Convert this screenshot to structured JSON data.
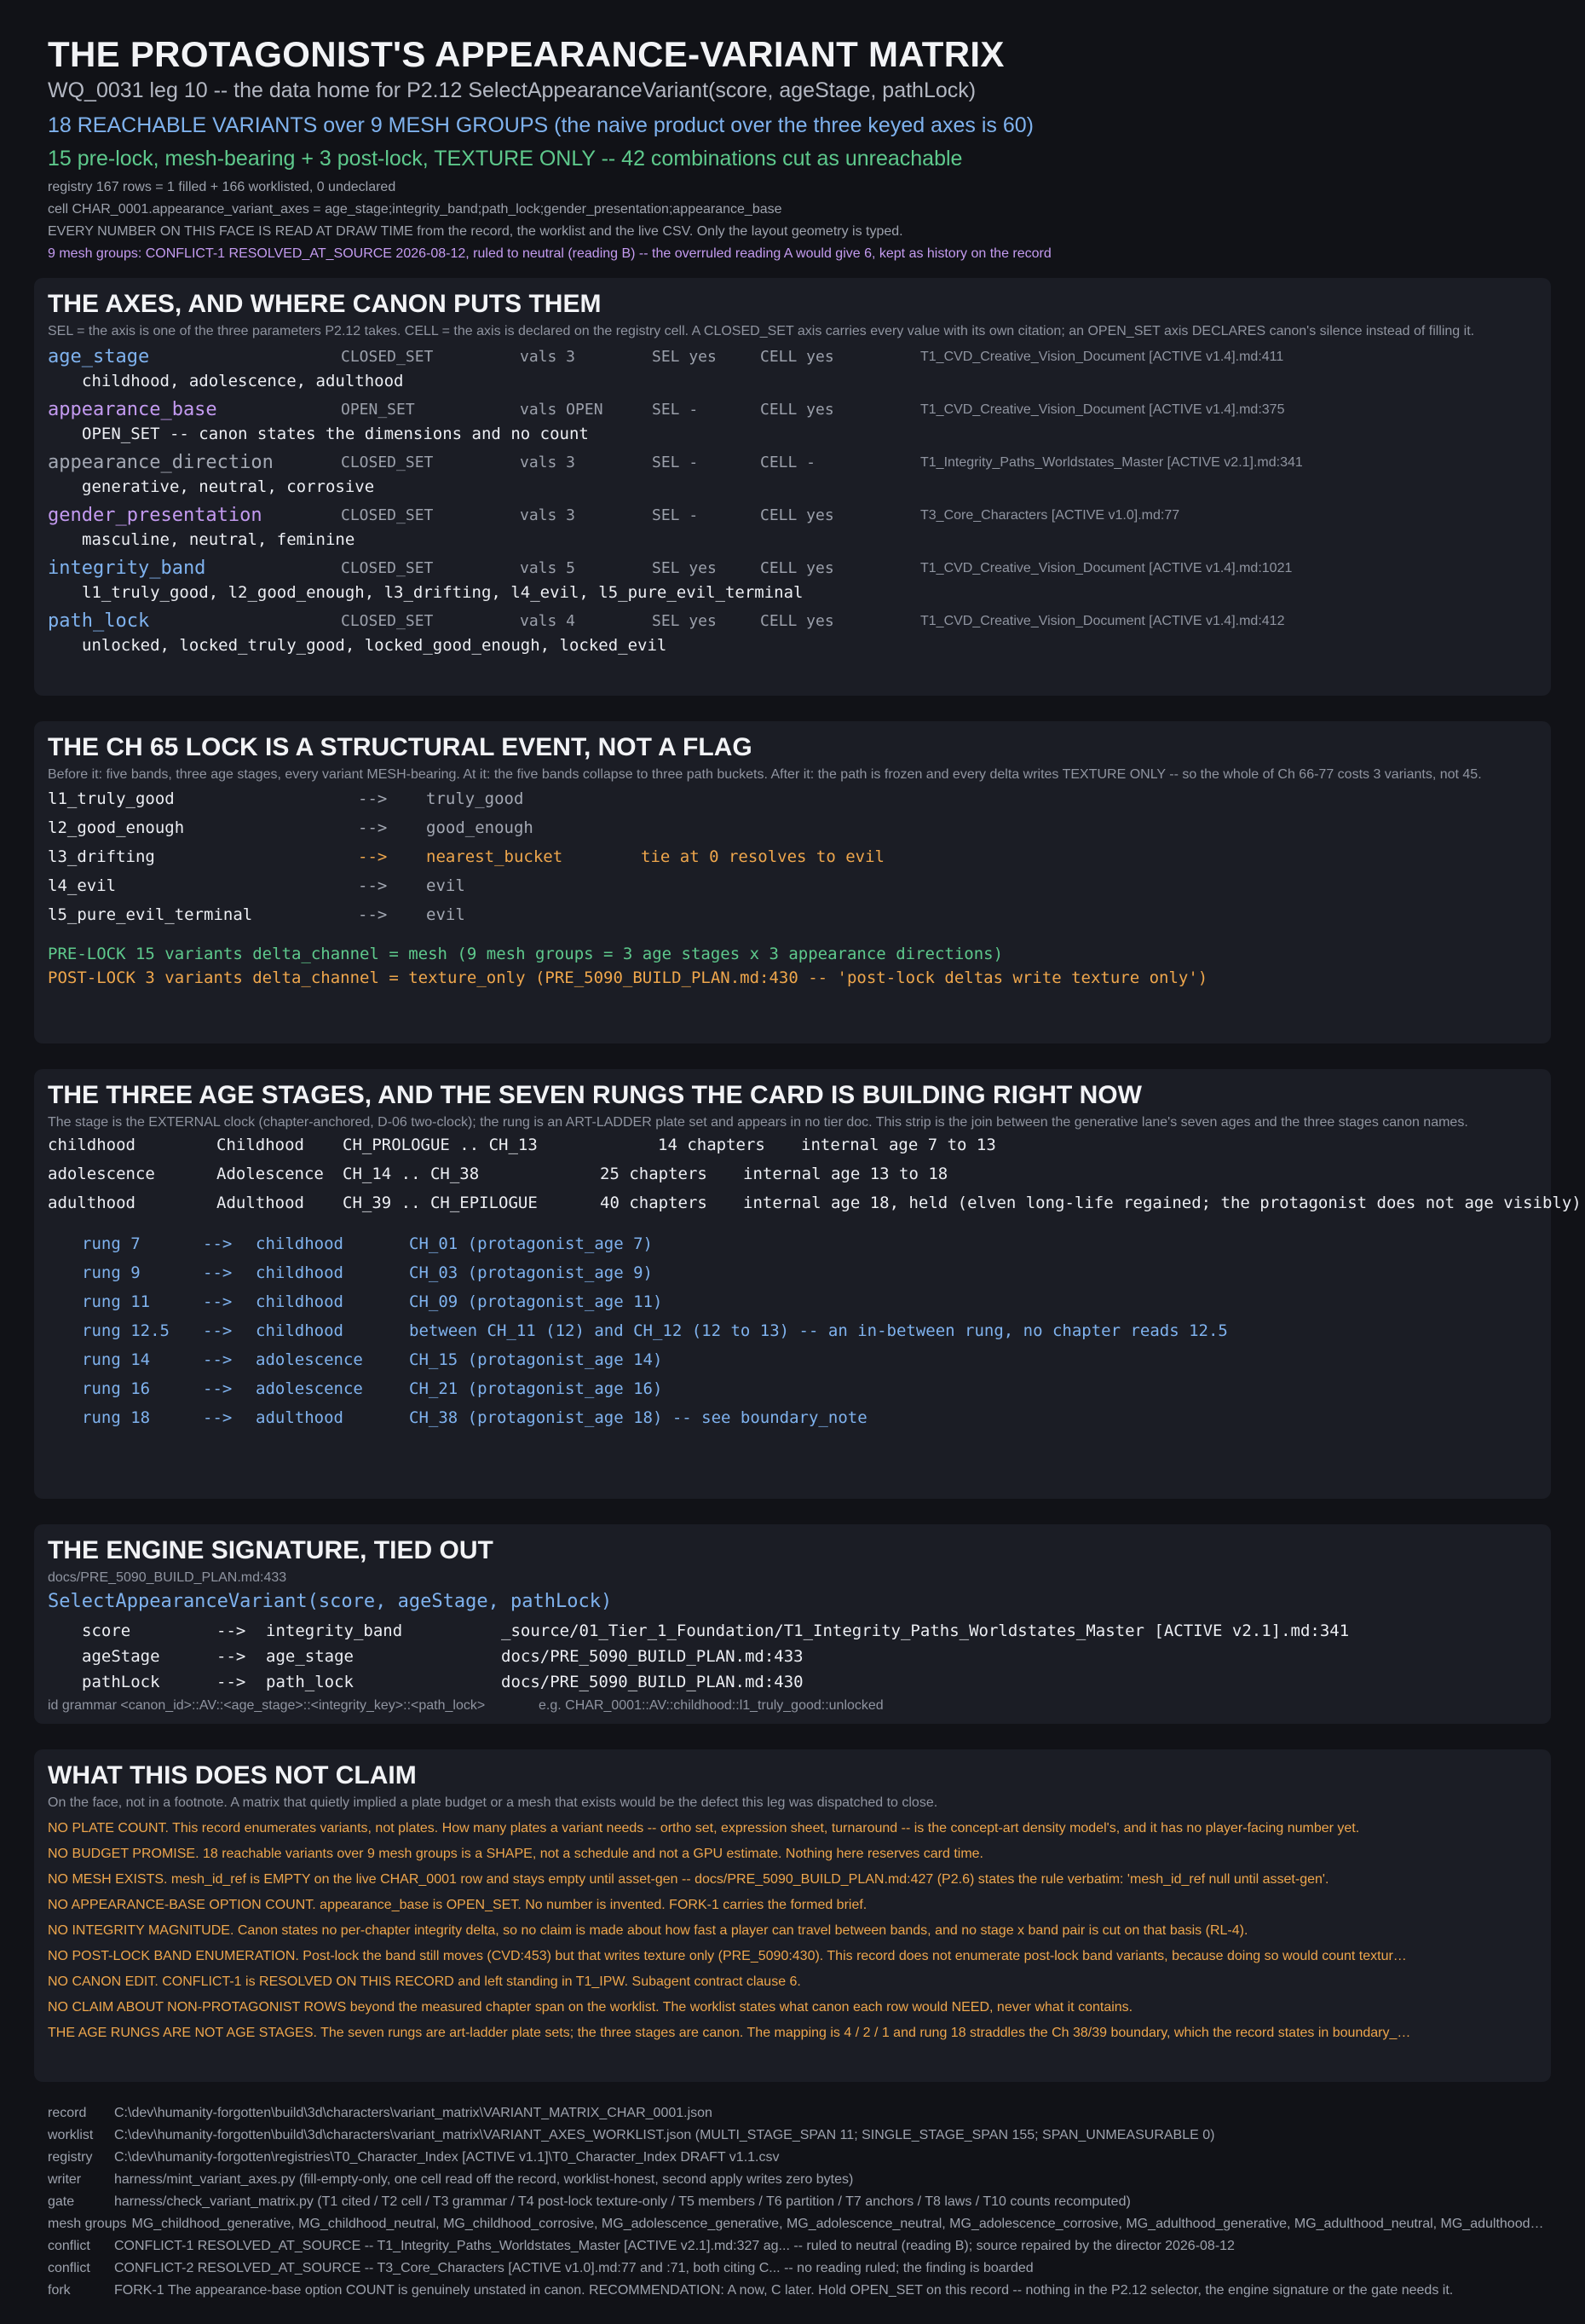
{
  "header": {
    "title": "THE PROTAGONIST'S APPEARANCE-VARIANT MATRIX",
    "subtitle": "WQ_0031 leg 10  --  the data home for P2.12  SelectAppearanceVariant(score, ageStage, pathLock)",
    "headline_blue": "18 REACHABLE VARIANTS over 9 MESH GROUPS   (the naive product over the three keyed axes is 60)",
    "headline_green": "15 pre-lock, mesh-bearing   +   3 post-lock, TEXTURE ONLY   --   42 combinations cut as unreachable",
    "registry_line": "registry  167 rows = 1 filled + 166 worklisted, 0 undeclared",
    "cell_line": "cell      CHAR_0001.appearance_variant_axes = age_stage;integrity_band;path_lock;gender_presentation;appearance_base",
    "read_note": "EVERY NUMBER ON THIS FACE IS READ AT DRAW TIME from the record, the worklist and the live CSV. Only the layout geometry is typed.",
    "conflict_note": "9 mesh groups: CONFLICT-1 RESOLVED_AT_SOURCE 2026-08-12, ruled to neutral (reading B) -- the overruled reading A would give 6, kept as history on the record"
  },
  "axes": {
    "heading": "THE AXES, AND WHERE CANON PUTS THEM",
    "desc": "SEL = the axis is one of the three parameters P2.12 takes. CELL = the axis is declared on the registry cell. A CLOSED_SET axis carries every value with its own citation; an OPEN_SET axis DECLARES canon's silence instead of filling it.",
    "rows": [
      {
        "name": "age_stage",
        "type": "CLOSED_SET",
        "vals": "vals 3",
        "sel": "SEL yes",
        "cell": "CELL yes",
        "cite": "T1_CVD_Creative_Vision_Document [ACTIVE v1.4].md:411",
        "values": "childhood, adolescence, adulthood"
      },
      {
        "name": "appearance_base",
        "type": "OPEN_SET",
        "vals": "vals OPEN",
        "sel": "SEL -",
        "cell": "CELL yes",
        "cite": "T1_CVD_Creative_Vision_Document [ACTIVE v1.4].md:375",
        "values": "OPEN_SET -- canon states the dimensions and no count"
      },
      {
        "name": "appearance_direction",
        "type": "CLOSED_SET",
        "vals": "vals 3",
        "sel": "SEL -",
        "cell": "CELL -",
        "cite": "T1_Integrity_Paths_Worldstates_Master [ACTIVE v2.1].md:341",
        "values": "generative, neutral, corrosive"
      },
      {
        "name": "gender_presentation",
        "type": "CLOSED_SET",
        "vals": "vals 3",
        "sel": "SEL -",
        "cell": "CELL yes",
        "cite": "T3_Core_Characters [ACTIVE v1.0].md:77",
        "values": "masculine, neutral, feminine"
      },
      {
        "name": "integrity_band",
        "type": "CLOSED_SET",
        "vals": "vals 5",
        "sel": "SEL yes",
        "cell": "CELL yes",
        "cite": "T1_CVD_Creative_Vision_Document [ACTIVE v1.4].md:1021",
        "values": "l1_truly_good, l2_good_enough, l3_drifting, l4_evil, l5_pure_evil_terminal"
      },
      {
        "name": "path_lock",
        "type": "CLOSED_SET",
        "vals": "vals 4",
        "sel": "SEL yes",
        "cell": "CELL yes",
        "cite": "T1_CVD_Creative_Vision_Document [ACTIVE v1.4].md:412",
        "values": "unlocked, locked_truly_good, locked_good_enough, locked_evil"
      }
    ]
  },
  "lock": {
    "heading": "THE CH 65 LOCK IS A STRUCTURAL EVENT, NOT A FLAG",
    "desc": "Before it: five bands, three age stages, every variant MESH-bearing. At it: the five bands collapse to three path buckets. After it: the path is frozen and every delta writes TEXTURE ONLY -- so the whole of Ch 66-77 costs 3 variants, not 45.",
    "rows": [
      {
        "from": "l1_truly_good",
        "arrow": "-->",
        "to": "truly_good",
        "note": ""
      },
      {
        "from": "l2_good_enough",
        "arrow": "-->",
        "to": "good_enough",
        "note": ""
      },
      {
        "from": "l3_drifting",
        "arrow": "-->",
        "to": "nearest_bucket",
        "note": "tie at 0 resolves to evil"
      },
      {
        "from": "l4_evil",
        "arrow": "-->",
        "to": "evil",
        "note": ""
      },
      {
        "from": "l5_pure_evil_terminal",
        "arrow": "-->",
        "to": "evil",
        "note": ""
      }
    ],
    "pre_lock": "PRE-LOCK  15 variants  delta_channel = mesh        (9 mesh groups = 3 age stages x 3 appearance directions)",
    "post_lock": "POST-LOCK 3 variants  delta_channel = texture_only   (PRE_5090_BUILD_PLAN.md:430 -- 'post-lock deltas write texture only')"
  },
  "ages": {
    "heading": "THE THREE AGE STAGES, AND THE SEVEN RUNGS THE CARD IS BUILDING RIGHT NOW",
    "desc": "The stage is the EXTERNAL clock (chapter-anchored, D-06 two-clock); the rung is an ART-LADDER plate set and appears in no tier doc. This strip is the join between the generative lane's seven ages and the three stages canon names.",
    "stages": [
      {
        "key": "childhood",
        "label": "Childhood",
        "span": "CH_PROLOGUE .. CH_13",
        "chapters": "14 chapters",
        "internal": "internal age 7 to 13"
      },
      {
        "key": "adolescence",
        "label": "Adolescence",
        "span": "CH_14 .. CH_38",
        "chapters": "25 chapters",
        "internal": "internal age 13 to 18"
      },
      {
        "key": "adulthood",
        "label": "Adulthood",
        "span": "CH_39 .. CH_EPILOGUE",
        "chapters": "40 chapters",
        "internal": "internal age 18, held (elven long-life regained; the protagonist does not age visibly)"
      }
    ],
    "rungs": [
      {
        "rung": "rung 7",
        "arrow": "-->",
        "stage": "childhood",
        "target": "CH_01 (protagonist_age 7)"
      },
      {
        "rung": "rung 9",
        "arrow": "-->",
        "stage": "childhood",
        "target": "CH_03 (protagonist_age 9)"
      },
      {
        "rung": "rung 11",
        "arrow": "-->",
        "stage": "childhood",
        "target": "CH_09 (protagonist_age 11)"
      },
      {
        "rung": "rung 12.5",
        "arrow": "-->",
        "stage": "childhood",
        "target": "between CH_11 (12) and CH_12 (12 to 13) -- an in-between rung, no chapter reads 12.5"
      },
      {
        "rung": "rung 14",
        "arrow": "-->",
        "stage": "adolescence",
        "target": "CH_15 (protagonist_age 14)"
      },
      {
        "rung": "rung 16",
        "arrow": "-->",
        "stage": "adolescence",
        "target": "CH_21 (protagonist_age 16)"
      },
      {
        "rung": "rung 18",
        "arrow": "-->",
        "stage": "adulthood",
        "target": "CH_38 (protagonist_age 18) -- see boundary_note"
      }
    ]
  },
  "engine": {
    "heading": "THE ENGINE SIGNATURE, TIED OUT",
    "source": "docs/PRE_5090_BUILD_PLAN.md:433",
    "signature": "SelectAppearanceVariant(score, ageStage, pathLock)",
    "params": [
      {
        "param": "score",
        "arrow": "-->",
        "axis": "integrity_band",
        "cite": "_source/01_Tier_1_Foundation/T1_Integrity_Paths_Worldstates_Master [ACTIVE v2.1].md:341"
      },
      {
        "param": "ageStage",
        "arrow": "-->",
        "axis": "age_stage",
        "cite": "docs/PRE_5090_BUILD_PLAN.md:433"
      },
      {
        "param": "pathLock",
        "arrow": "-->",
        "axis": "path_lock",
        "cite": "docs/PRE_5090_BUILD_PLAN.md:430"
      }
    ],
    "grammar": "id grammar  <canon_id>::AV::<age_stage>::<integrity_key>::<path_lock>",
    "example": "e.g.  CHAR_0001::AV::childhood::l1_truly_good::unlocked"
  },
  "claims": {
    "heading": "WHAT THIS DOES NOT CLAIM",
    "desc": "On the face, not in a footnote. A matrix that quietly implied a plate budget or a mesh that exists would be the defect this leg was dispatched to close.",
    "items": [
      "NO PLATE COUNT. This record enumerates variants, not plates. How many plates a variant needs -- ortho set, expression sheet, turnaround -- is the concept-art density model's, and it has no player-facing number yet.",
      "NO BUDGET PROMISE. 18 reachable variants over 9 mesh groups is a SHAPE, not a schedule and not a GPU estimate. Nothing here reserves card time.",
      "NO MESH EXISTS. mesh_id_ref is EMPTY on the live CHAR_0001 row and stays empty until asset-gen -- docs/PRE_5090_BUILD_PLAN.md:427 (P2.6) states the rule verbatim: 'mesh_id_ref null until asset-gen'.",
      "NO APPEARANCE-BASE OPTION COUNT. appearance_base is OPEN_SET. No number is invented. FORK-1 carries the formed brief.",
      "NO INTEGRITY MAGNITUDE. Canon states no per-chapter integrity delta, so no claim is made about how fast a player can travel between bands, and no stage x band pair is cut on that basis (RL-4).",
      "NO POST-LOCK BAND ENUMERATION. Post-lock the band still moves (CVD:453) but that writes texture only (PRE_5090:430). This record does not enumerate post-lock band variants, because doing so would count texture states as meshes.",
      "NO CANON EDIT. CONFLICT-1 is RESOLVED ON THIS RECORD and left standing in T1_IPW. Subagent contract clause 6.",
      "NO CLAIM ABOUT NON-PROTAGONIST ROWS beyond the measured chapter span on the worklist. The worklist states what canon each row would NEED, never what it contains.",
      "THE AGE RUNGS ARE NOT AGE STAGES. The seven rungs are art-ladder plate sets; the three stages are canon. The mapping is 4 / 2 / 1 and rung 18 straddles the Ch 38/39 boundary, which the record states in boundary_note."
    ]
  },
  "footer": [
    {
      "label": "record",
      "text": "C:\\dev\\humanity-forgotten\\build\\3d\\characters\\variant_matrix\\VARIANT_MATRIX_CHAR_0001.json"
    },
    {
      "label": "worklist",
      "text": "C:\\dev\\humanity-forgotten\\build\\3d\\characters\\variant_matrix\\VARIANT_AXES_WORKLIST.json  (MULTI_STAGE_SPAN 11; SINGLE_STAGE_SPAN 155; SPAN_UNMEASURABLE 0)"
    },
    {
      "label": "registry",
      "text": "C:\\dev\\humanity-forgotten\\registries\\T0_Character_Index [ACTIVE v1.1]\\T0_Character_Index DRAFT v1.1.csv"
    },
    {
      "label": "writer",
      "text": "harness/mint_variant_axes.py (fill-empty-only, one cell read off the record, worklist-honest, second apply writes zero bytes)"
    },
    {
      "label": "gate",
      "text": "harness/check_variant_matrix.py (T1 cited / T2 cell / T3 grammar / T4 post-lock texture-only / T5 members / T6 partition / T7 anchors / T8 laws / T10 counts recomputed)"
    },
    {
      "label": "mesh groups",
      "text": "MG_childhood_generative, MG_childhood_neutral, MG_childhood_corrosive, MG_adolescence_generative, MG_adolescence_neutral, MG_adolescence_corrosive, MG_adulthood_generative, MG_adulthood_neutral, MG_adulthood_corrosive"
    },
    {
      "label": "conflict",
      "text": "CONFLICT-1  RESOLVED_AT_SOURCE  --  T1_Integrity_Paths_Worldstates_Master [ACTIVE v2.1].md:327 ag...  --  ruled to neutral (reading B); source repaired by the director 2026-08-12"
    },
    {
      "label": "conflict",
      "text": "CONFLICT-2  RESOLVED_AT_SOURCE  --  T3_Core_Characters [ACTIVE v1.0].md:77 and :71, both citing C...  --  no reading ruled; the finding is boarded"
    },
    {
      "label": "fork",
      "text": "FORK-1  The appearance-base option COUNT is genuinely unstated in canon. RECOMMENDATION: A now, C later. Hold OPEN_SET on this record -- nothing in the P2.12 selector, the engine signature or the gate needs it."
    }
  ],
  "colors": {
    "background": "#111217",
    "panel": "#1b1d25",
    "blue": "#7fb2ee",
    "green": "#5ec98c",
    "orange": "#eea64c",
    "purple": "#c39af0"
  }
}
